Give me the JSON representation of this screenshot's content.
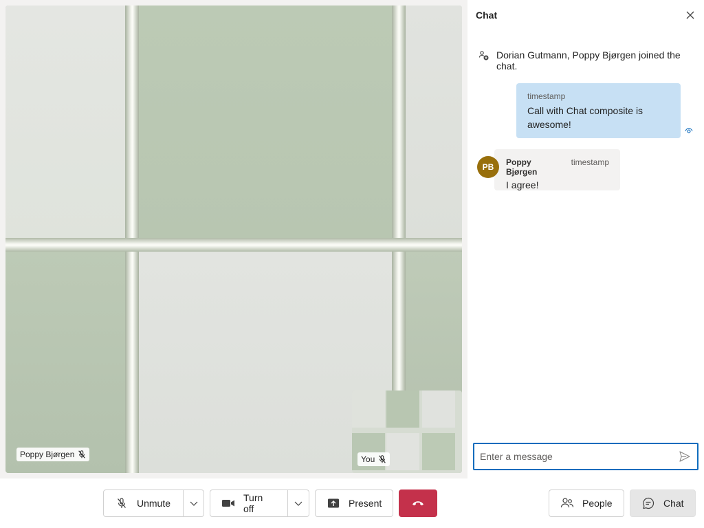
{
  "video": {
    "remote_participant": {
      "name": "Poppy Bjørgen",
      "muted_icon": "mic-off-icon"
    },
    "local_preview": {
      "label": "You",
      "muted_icon": "mic-off-icon"
    }
  },
  "chat": {
    "title": "Chat",
    "close_icon": "close-icon",
    "system_message": "Dorian Gutmann, Poppy Bjørgen joined the chat.",
    "messages": [
      {
        "mine": true,
        "timestamp": "timestamp",
        "text": "Call with Chat composite is awesome!",
        "status_icon": "read-receipt-icon"
      },
      {
        "mine": false,
        "sender": "Poppy Bjørgen",
        "initials": "PB",
        "timestamp": "timestamp",
        "text": "I agree!"
      }
    ],
    "composer": {
      "placeholder": "Enter a message",
      "value": "",
      "send_icon": "send-icon"
    }
  },
  "controls": {
    "unmute_label": "Unmute",
    "camera_label": "Turn off",
    "present_label": "Present",
    "people_label": "People",
    "chat_label": "Chat"
  },
  "colors": {
    "accent": "#0f6cbd",
    "end_call": "#c4314b",
    "my_bubble": "#c7e0f4",
    "avatar_pb": "#986f0b"
  }
}
